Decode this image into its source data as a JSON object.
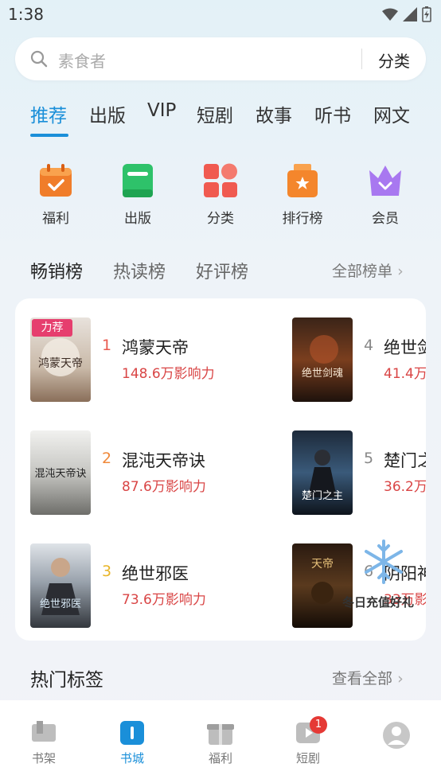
{
  "status_bar": {
    "time": "1:38"
  },
  "search": {
    "placeholder": "素食者",
    "category_button": "分类"
  },
  "top_tabs": [
    "推荐",
    "出版",
    "VIP",
    "短剧",
    "故事",
    "听书",
    "网文"
  ],
  "quick_entries": [
    {
      "label": "福利",
      "icon": "gift-calendar-icon",
      "color": "#f07d2a"
    },
    {
      "label": "出版",
      "icon": "book-icon",
      "color": "#2ec26a"
    },
    {
      "label": "分类",
      "icon": "category-grid-icon",
      "color": "#f05a50"
    },
    {
      "label": "排行榜",
      "icon": "trophy-icon",
      "color": "#f4862c"
    },
    {
      "label": "会员",
      "icon": "crown-icon",
      "color": "#a878f0"
    }
  ],
  "rank_tabs": [
    "畅销榜",
    "热读榜",
    "好评榜"
  ],
  "rank_all_label": "全部榜单",
  "rank_books": [
    {
      "rank": "1",
      "title": "鸿蒙天帝",
      "heat": "148.6万影响力",
      "badge": "力荐"
    },
    {
      "rank": "2",
      "title": "混沌天帝诀",
      "heat": "87.6万影响力"
    },
    {
      "rank": "3",
      "title": "绝世邪医",
      "heat": "73.6万影响力"
    },
    {
      "rank": "4",
      "title": "绝世剑",
      "heat": "41.4万"
    },
    {
      "rank": "5",
      "title": "楚门之",
      "heat": "36.2万"
    },
    {
      "rank": "6",
      "title": "阴阳神",
      "heat": "33万影"
    }
  ],
  "promo_text": "冬日充值好礼",
  "hot_tags": {
    "title": "热门标签",
    "more": "查看全部"
  },
  "bottom_nav": [
    {
      "label": "书架",
      "icon": "bookshelf-icon"
    },
    {
      "label": "书城",
      "icon": "bookstore-icon"
    },
    {
      "label": "福利",
      "icon": "gift-box-icon"
    },
    {
      "label": "短剧",
      "icon": "video-icon",
      "badge": "1"
    },
    {
      "label": "",
      "icon": "avatar-icon"
    }
  ],
  "colors": {
    "accent": "#1a8fd9",
    "heat": "#d94545",
    "badge": "#e63e6e"
  }
}
